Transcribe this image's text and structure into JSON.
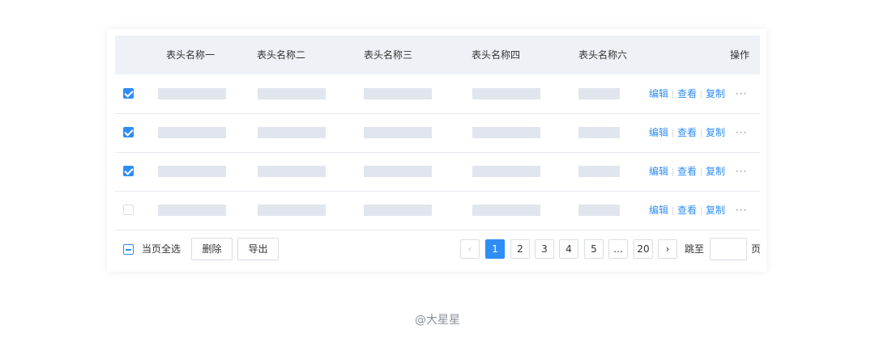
{
  "table": {
    "headers": [
      "表头名称一",
      "表头名称二",
      "表头名称三",
      "表头名称四",
      "表头名称六"
    ],
    "actions_header": "操作",
    "rows": [
      {
        "checked": true
      },
      {
        "checked": true
      },
      {
        "checked": true
      },
      {
        "checked": false
      }
    ],
    "row_actions": {
      "edit": "编辑",
      "view": "查看",
      "copy": "复制",
      "more": "···"
    }
  },
  "footer": {
    "select_all_label": "当页全选",
    "delete_label": "删除",
    "export_label": "导出"
  },
  "pagination": {
    "prev": "‹",
    "next": "›",
    "pages": [
      "1",
      "2",
      "3",
      "4",
      "5",
      "...",
      "20"
    ],
    "current": "1",
    "jump_label": "跳至",
    "jump_value": "",
    "page_suffix": "页"
  },
  "watermark": "@大星星",
  "colors": {
    "accent": "#2f8ef5",
    "header_bg": "#eef1f6",
    "placeholder": "#e1e5ed"
  }
}
